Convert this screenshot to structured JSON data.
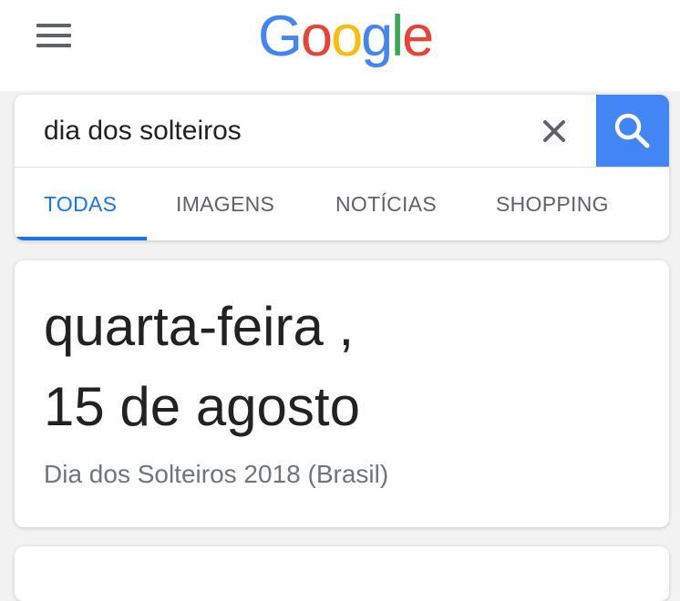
{
  "header": {
    "logo_letters": [
      {
        "char": "G",
        "color": "#4285f4"
      },
      {
        "char": "o",
        "color": "#ea4335"
      },
      {
        "char": "o",
        "color": "#fbbc05"
      },
      {
        "char": "g",
        "color": "#4285f4"
      },
      {
        "char": "l",
        "color": "#34a853"
      },
      {
        "char": "e",
        "color": "#ea4335"
      }
    ],
    "menu_icon": "hamburger-menu-icon"
  },
  "search": {
    "query": "dia dos solteiros",
    "clear_icon": "close-icon",
    "search_icon": "search-icon",
    "button_color": "#4285f4"
  },
  "tabs": [
    {
      "label": "TODAS",
      "active": true
    },
    {
      "label": "IMAGENS",
      "active": false
    },
    {
      "label": "NOTÍCIAS",
      "active": false
    },
    {
      "label": "SHOPPING",
      "active": false
    }
  ],
  "answer": {
    "line1": "quarta-feira ,",
    "line2": "15 de agosto",
    "subtitle": "Dia dos Solteiros 2018 (Brasil)"
  },
  "colors": {
    "accent": "#1a73e8",
    "text_primary": "#222222",
    "text_secondary": "#70757a"
  }
}
